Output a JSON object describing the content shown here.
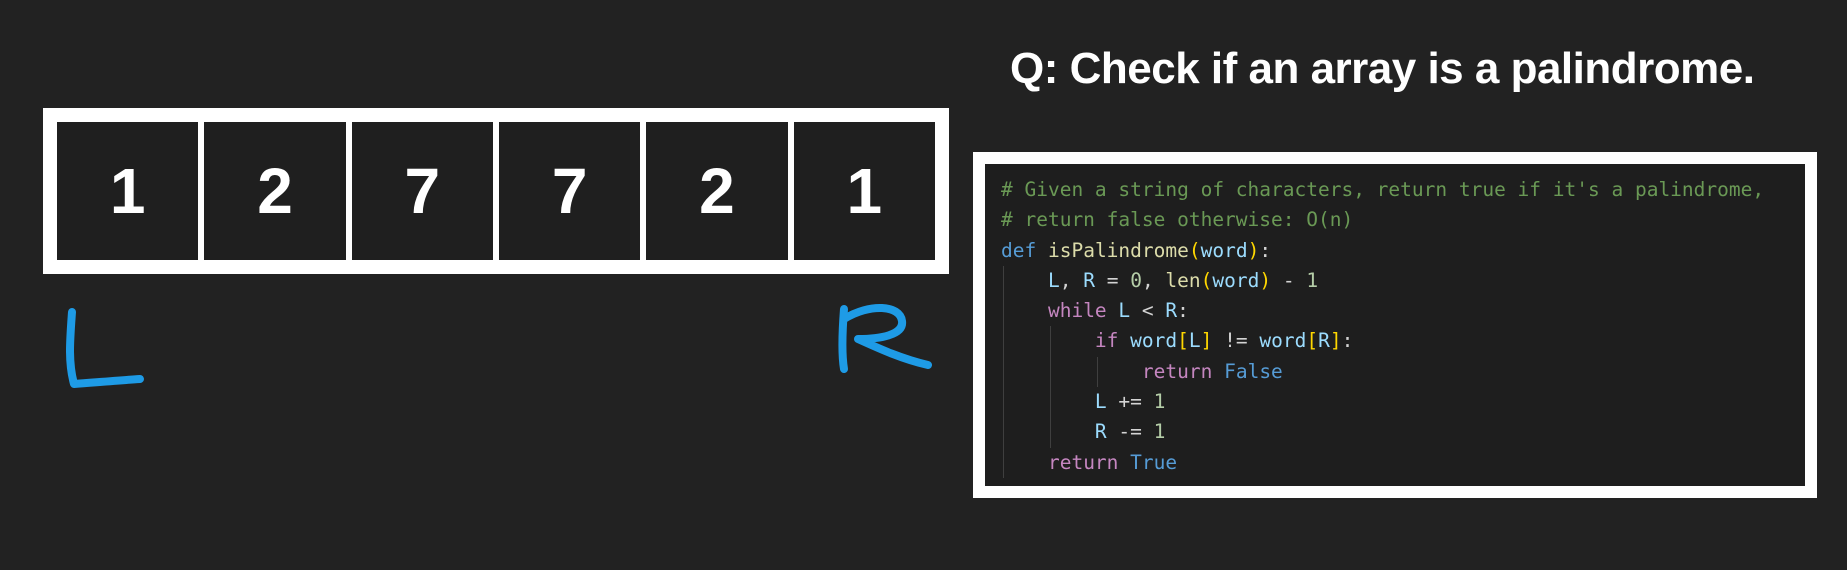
{
  "title": "Q: Check if an array is a palindrome.",
  "array": {
    "values": [
      "1",
      "2",
      "7",
      "7",
      "2",
      "1"
    ]
  },
  "pointers": {
    "left": "L",
    "right": "R",
    "color": "#1e9be6"
  },
  "code": {
    "lines": [
      {
        "indent": 0,
        "tokens": [
          {
            "t": "# Given a string of characters, return true if it's a palindrome,",
            "c": "cm"
          }
        ]
      },
      {
        "indent": 0,
        "tokens": [
          {
            "t": "# return false otherwise: O(n)",
            "c": "cm"
          }
        ]
      },
      {
        "indent": 0,
        "tokens": [
          {
            "t": "def",
            "c": "kw"
          },
          {
            "t": " ",
            "c": "op"
          },
          {
            "t": "isPalindrome",
            "c": "fn"
          },
          {
            "t": "(",
            "c": "br"
          },
          {
            "t": "word",
            "c": "var"
          },
          {
            "t": ")",
            "c": "br"
          },
          {
            "t": ":",
            "c": "op"
          }
        ]
      },
      {
        "indent": 1,
        "tokens": [
          {
            "t": "L",
            "c": "var"
          },
          {
            "t": ", ",
            "c": "op"
          },
          {
            "t": "R",
            "c": "var"
          },
          {
            "t": " = ",
            "c": "op"
          },
          {
            "t": "0",
            "c": "num"
          },
          {
            "t": ", ",
            "c": "op"
          },
          {
            "t": "len",
            "c": "fn"
          },
          {
            "t": "(",
            "c": "br"
          },
          {
            "t": "word",
            "c": "var"
          },
          {
            "t": ")",
            "c": "br"
          },
          {
            "t": " - ",
            "c": "op"
          },
          {
            "t": "1",
            "c": "num"
          }
        ]
      },
      {
        "indent": 1,
        "tokens": [
          {
            "t": "while",
            "c": "ctl"
          },
          {
            "t": " ",
            "c": "op"
          },
          {
            "t": "L",
            "c": "var"
          },
          {
            "t": " < ",
            "c": "op"
          },
          {
            "t": "R",
            "c": "var"
          },
          {
            "t": ":",
            "c": "op"
          }
        ]
      },
      {
        "indent": 2,
        "tokens": [
          {
            "t": "if",
            "c": "ctl"
          },
          {
            "t": " ",
            "c": "op"
          },
          {
            "t": "word",
            "c": "var"
          },
          {
            "t": "[",
            "c": "br"
          },
          {
            "t": "L",
            "c": "var"
          },
          {
            "t": "]",
            "c": "br"
          },
          {
            "t": " != ",
            "c": "op"
          },
          {
            "t": "word",
            "c": "var"
          },
          {
            "t": "[",
            "c": "br"
          },
          {
            "t": "R",
            "c": "var"
          },
          {
            "t": "]",
            "c": "br"
          },
          {
            "t": ":",
            "c": "op"
          }
        ]
      },
      {
        "indent": 3,
        "tokens": [
          {
            "t": "return",
            "c": "ctl"
          },
          {
            "t": " ",
            "c": "op"
          },
          {
            "t": "False",
            "c": "kw"
          }
        ]
      },
      {
        "indent": 2,
        "tokens": [
          {
            "t": "L",
            "c": "var"
          },
          {
            "t": " += ",
            "c": "op"
          },
          {
            "t": "1",
            "c": "num"
          }
        ]
      },
      {
        "indent": 2,
        "tokens": [
          {
            "t": "R",
            "c": "var"
          },
          {
            "t": " -= ",
            "c": "op"
          },
          {
            "t": "1",
            "c": "num"
          }
        ]
      },
      {
        "indent": 1,
        "tokens": [
          {
            "t": "return",
            "c": "ctl"
          },
          {
            "t": " ",
            "c": "op"
          },
          {
            "t": "True",
            "c": "kw"
          }
        ]
      }
    ]
  }
}
